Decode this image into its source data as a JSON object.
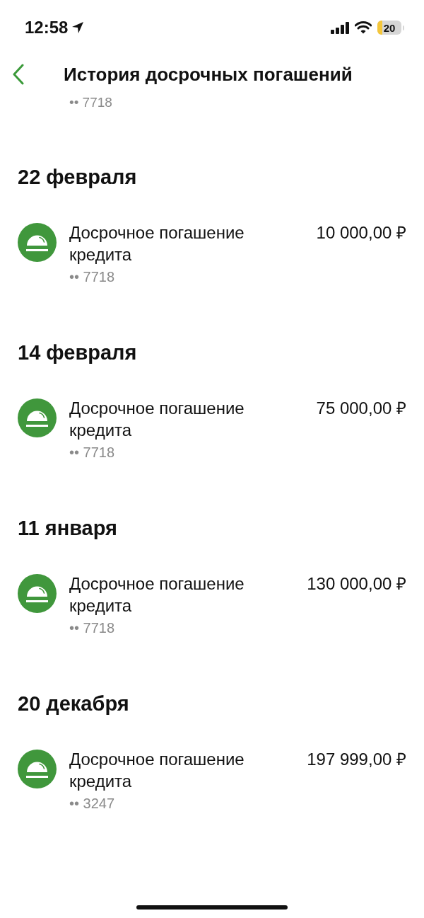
{
  "status_bar": {
    "time": "12:58",
    "battery": "20"
  },
  "header": {
    "title": "История досрочных погашений"
  },
  "clipped_card": "•• 7718",
  "sections": [
    {
      "date": "22 февраля",
      "operations": [
        {
          "title": "Досрочное погашение кредита",
          "card": "•• 7718",
          "amount": "10 000,00 ₽"
        }
      ]
    },
    {
      "date": "14 февраля",
      "operations": [
        {
          "title": "Досрочное погашение кредита",
          "card": "•• 7718",
          "amount": "75 000,00 ₽"
        }
      ]
    },
    {
      "date": "11 января",
      "operations": [
        {
          "title": "Досрочное погашение кредита",
          "card": "•• 7718",
          "amount": "130 000,00 ₽"
        }
      ]
    },
    {
      "date": "20 декабря",
      "operations": [
        {
          "title": "Досрочное погашение кредита",
          "card": "•• 3247",
          "amount": "197 999,00 ₽"
        }
      ]
    }
  ]
}
